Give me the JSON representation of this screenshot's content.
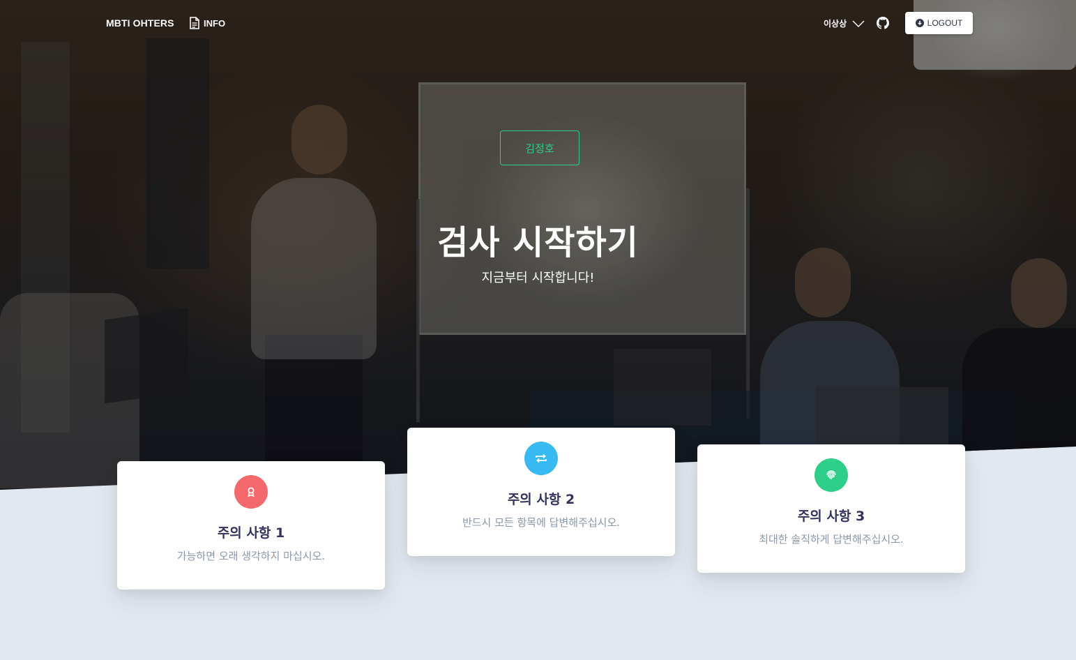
{
  "navbar": {
    "brand": "MBTI OHTERS",
    "info_label": "INFO",
    "user_name": "이상상",
    "logout_label": "LOGOUT"
  },
  "hero": {
    "name_button": "김정호",
    "title": "검사 시작하기",
    "subtitle": "지금부터 시작합니다!"
  },
  "cards": [
    {
      "title": "주의 사항 1",
      "text": "가능하면 오래 생각하지 마십시오.",
      "icon": "award-icon",
      "color": "#f5686b"
    },
    {
      "title": "주의 사항 2",
      "text": "반드시 모든 항목에 답변해주십시오.",
      "icon": "repeat-icon",
      "color": "#37b9f1"
    },
    {
      "title": "주의 사항 3",
      "text": "최대한 솔직하게 답변해주십시오.",
      "icon": "fingerprint-icon",
      "color": "#2dce89"
    }
  ],
  "colors": {
    "accent_green": "#2dce89",
    "page_bg": "#e2e8f0",
    "heading": "#32325d",
    "muted": "#8898aa"
  }
}
